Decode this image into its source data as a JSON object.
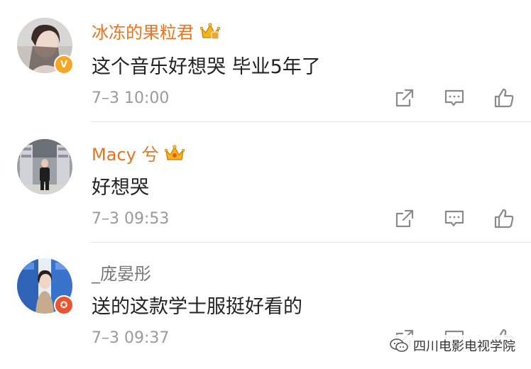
{
  "comments": [
    {
      "username": "冰冻的果粒君",
      "text": "这个音乐好想哭 毕业5年了",
      "time": "7–3 10:00",
      "username_color": "#e8741c",
      "badge": "gold-verified-icon",
      "vip": "crown-icon"
    },
    {
      "username": "Macy 兮",
      "text": "好想哭",
      "time": "7–3 09:53",
      "username_color": "#e8741c",
      "vip": "crown-icon"
    },
    {
      "username": "_庞晏彤",
      "text": "送的这款学士服挺好看的",
      "time": "7–3 09:37",
      "username_color": "#777777",
      "badge": "red-star-badge-icon"
    }
  ],
  "actions": [
    "share-icon",
    "comment-icon",
    "like-icon"
  ],
  "watermark": {
    "text": "四川电影电视学院",
    "icon": "wechat-icon"
  },
  "colors": {
    "name_highlight": "#e8741c",
    "text": "#222222",
    "muted": "#9a9a9a",
    "icon": "#8a8a8a"
  }
}
